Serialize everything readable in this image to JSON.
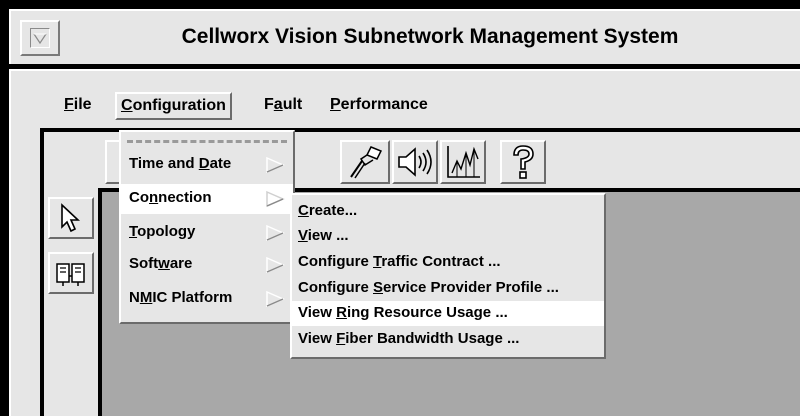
{
  "window": {
    "title": "Cellworx Vision Subnetwork Management System"
  },
  "menubar": {
    "items": [
      {
        "id": "file",
        "label": "File",
        "mnemonic": "F",
        "rest": "ile"
      },
      {
        "id": "configuration",
        "label": "Configuration",
        "mnemonic": "C",
        "rest": "onfiguration"
      },
      {
        "id": "fault",
        "label": "Fault",
        "pre": "F",
        "mnemonic": "a",
        "rest": "ult"
      },
      {
        "id": "performance",
        "label": "Performance",
        "mnemonic": "P",
        "rest": "erformance"
      }
    ],
    "active": "Configuration"
  },
  "configuration_menu": {
    "items": [
      {
        "label": "Time and Date",
        "pre": "Time and ",
        "mnemonic": "D",
        "rest": "ate"
      },
      {
        "label": "Connection",
        "pre": "Co",
        "mnemonic": "n",
        "rest": "nection",
        "highlighted": true
      },
      {
        "label": "Topology",
        "pre": "",
        "mnemonic": "T",
        "rest": "opology"
      },
      {
        "label": "Software",
        "pre": "Soft",
        "mnemonic": "w",
        "rest": "are"
      },
      {
        "label": "NMIC Platform",
        "pre": "N",
        "mnemonic": "M",
        "rest": "IC Platform"
      }
    ]
  },
  "connection_submenu": {
    "items": [
      {
        "label": "Create...",
        "pre": "",
        "mnemonic": "C",
        "rest": "reate..."
      },
      {
        "label": "View ...",
        "pre": "",
        "mnemonic": "V",
        "rest": "iew ..."
      },
      {
        "label": "Configure Traffic Contract ...",
        "pre": "Configure ",
        "mnemonic": "T",
        "rest": "raffic Contract ..."
      },
      {
        "label": "Configure Service Provider Profile ...",
        "pre": "Configure ",
        "mnemonic": "S",
        "rest": "ervice Provider Profile ..."
      },
      {
        "label": "View Ring Resource Usage ...",
        "pre": "View ",
        "mnemonic": "R",
        "rest": "ing Resource Usage ...",
        "highlighted": true
      },
      {
        "label": "View Fiber Bandwidth Usage ...",
        "pre": "View ",
        "mnemonic": "F",
        "rest": "iber Bandwidth Usage ..."
      }
    ]
  },
  "toolbar": {
    "icons": [
      "connector-icon",
      "speaker-icon",
      "performance-chart-icon",
      "help-icon"
    ]
  },
  "palette": {
    "icons": [
      "select-arrow-icon",
      "network-elements-icon"
    ]
  },
  "colors": {
    "panel": "#e6e6e6",
    "canvas": "#a8a8a8",
    "highlight": "#ffffff",
    "frame": "#000000"
  }
}
